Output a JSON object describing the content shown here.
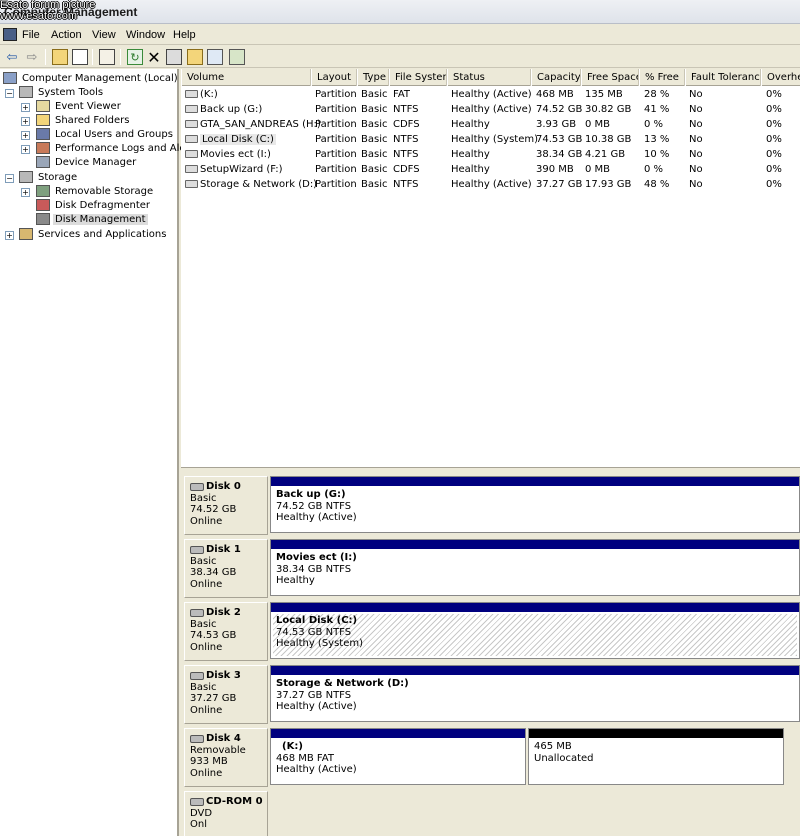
{
  "watermark": {
    "line1": "Esato forum picture",
    "line2": "www.esato.com"
  },
  "window": {
    "title": "Computer Management"
  },
  "menu": [
    "File",
    "Action",
    "View",
    "Window",
    "Help"
  ],
  "toolbar": {
    "icons": [
      "back-arrow-icon",
      "forward-arrow-icon",
      "up-folder-icon",
      "show-hide-tree-icon",
      "properties-icon",
      "refresh-icon",
      "delete-icon",
      "properties-sheet-icon",
      "open-folder-icon",
      "search-icon",
      "export-icon"
    ]
  },
  "tree": {
    "root": "Computer Management (Local)",
    "system_tools": "System Tools",
    "event_viewer": "Event Viewer",
    "shared_folders": "Shared Folders",
    "local_users": "Local Users and Groups",
    "perf_logs": "Performance Logs and Alerts",
    "device_manager": "Device Manager",
    "storage": "Storage",
    "removable_storage": "Removable Storage",
    "disk_defrag": "Disk Defragmenter",
    "disk_management": "Disk Management",
    "services": "Services and Applications"
  },
  "volumes": {
    "columns": [
      "Volume",
      "Layout",
      "Type",
      "File System",
      "Status",
      "Capacity",
      "Free Space",
      "% Free",
      "Fault Tolerance",
      "Overhead"
    ],
    "rows": [
      {
        "volume": "(K:)",
        "layout": "Partition",
        "type": "Basic",
        "fs": "FAT",
        "status": "Healthy (Active)",
        "capacity": "468 MB",
        "free": "135 MB",
        "pct": "28 %",
        "fault": "No",
        "overhead": "0%",
        "icon": "removable-drive-icon"
      },
      {
        "volume": "Back up (G:)",
        "layout": "Partition",
        "type": "Basic",
        "fs": "NTFS",
        "status": "Healthy (Active)",
        "capacity": "74.52 GB",
        "free": "30.82 GB",
        "pct": "41 %",
        "fault": "No",
        "overhead": "0%",
        "icon": "hard-drive-icon"
      },
      {
        "volume": "GTA_SAN_ANDREAS (H:)",
        "layout": "Partition",
        "type": "Basic",
        "fs": "CDFS",
        "status": "Healthy",
        "capacity": "3.93 GB",
        "free": "0 MB",
        "pct": "0 %",
        "fault": "No",
        "overhead": "0%",
        "icon": "cd-drive-icon"
      },
      {
        "volume": "Local Disk (C:)",
        "layout": "Partition",
        "type": "Basic",
        "fs": "NTFS",
        "status": "Healthy (System)",
        "capacity": "74.53 GB",
        "free": "10.38 GB",
        "pct": "13 %",
        "fault": "No",
        "overhead": "0%",
        "icon": "hard-drive-icon"
      },
      {
        "volume": "Movies ect (I:)",
        "layout": "Partition",
        "type": "Basic",
        "fs": "NTFS",
        "status": "Healthy",
        "capacity": "38.34 GB",
        "free": "4.21 GB",
        "pct": "10 %",
        "fault": "No",
        "overhead": "0%",
        "icon": "hard-drive-icon"
      },
      {
        "volume": "SetupWizard (F:)",
        "layout": "Partition",
        "type": "Basic",
        "fs": "CDFS",
        "status": "Healthy",
        "capacity": "390 MB",
        "free": "0 MB",
        "pct": "0 %",
        "fault": "No",
        "overhead": "0%",
        "icon": "cd-drive-icon"
      },
      {
        "volume": "Storage & Network (D:)",
        "layout": "Partition",
        "type": "Basic",
        "fs": "NTFS",
        "status": "Healthy (Active)",
        "capacity": "37.27 GB",
        "free": "17.93 GB",
        "pct": "48 %",
        "fault": "No",
        "overhead": "0%",
        "icon": "hard-drive-icon"
      }
    ]
  },
  "disks": [
    {
      "name": "Disk 0",
      "type": "Basic",
      "size": "74.52 GB",
      "state": "Online",
      "partitions": [
        {
          "name": "Back up  (G:)",
          "line2": "74.52 GB NTFS",
          "line3": "Healthy (Active)"
        }
      ]
    },
    {
      "name": "Disk 1",
      "type": "Basic",
      "size": "38.34 GB",
      "state": "Online",
      "partitions": [
        {
          "name": "Movies ect  (I:)",
          "line2": "38.34 GB NTFS",
          "line3": "Healthy"
        }
      ]
    },
    {
      "name": "Disk 2",
      "type": "Basic",
      "size": "74.53 GB",
      "state": "Online",
      "partitions": [
        {
          "name": "Local Disk  (C:)",
          "line2": "74.53 GB NTFS",
          "line3": "Healthy (System)"
        }
      ]
    },
    {
      "name": "Disk 3",
      "type": "Basic",
      "size": "37.27 GB",
      "state": "Online",
      "partitions": [
        {
          "name": "Storage & Network  (D:)",
          "line2": "37.27 GB NTFS",
          "line3": "Healthy (Active)"
        }
      ]
    },
    {
      "name": "Disk 4",
      "type": "Removable",
      "size": "933 MB",
      "state": "Online",
      "partitions": [
        {
          "name": "(K:)",
          "line2": "468 MB FAT",
          "line3": "Healthy (Active)"
        },
        {
          "name": "",
          "line2": "465 MB",
          "line3": "Unallocated"
        }
      ]
    },
    {
      "name": "CD-ROM 0",
      "type": "DVD",
      "size": "",
      "state": "Onl"
    }
  ],
  "colors": {
    "primary_partition": "#00007f",
    "unallocated": "#000000"
  }
}
